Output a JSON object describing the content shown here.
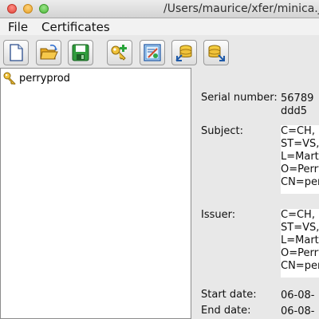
{
  "window": {
    "title": "/Users/maurice/xfer/minica.jks"
  },
  "menubar": {
    "file": "File",
    "certificates": "Certificates"
  },
  "toolbar": {
    "buttons": [
      "new-icon",
      "open-icon",
      "save-icon",
      "new-key-icon",
      "certificate-icon",
      "import-icon",
      "export-icon"
    ]
  },
  "tree": {
    "items": [
      {
        "label": "perryprod",
        "icon": "key-icon"
      }
    ]
  },
  "detail": {
    "serial_label": "Serial number:",
    "serial_line1": "56789",
    "serial_line2": "ddd5",
    "subject_label": "Subject:",
    "subject_lines": [
      "C=CH,",
      "ST=VS,",
      "L=Marti",
      "O=Perry",
      "CN=per"
    ],
    "issuer_label": "Issuer:",
    "issuer_lines": [
      "C=CH,",
      "ST=VS,",
      "L=Marti",
      "O=Perry",
      "CN=per"
    ],
    "start_label": "Start date:",
    "start_value": "06-08-",
    "end_label": "End date:",
    "end_value": "06-08-"
  },
  "colors": {
    "window_bg": "#e8e8e8",
    "panel_bg": "#ffffff"
  }
}
